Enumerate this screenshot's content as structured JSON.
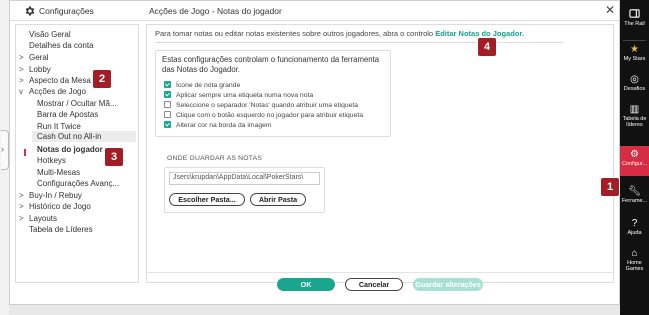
{
  "window": {
    "left_title": "Configurações",
    "right_title": "Acções de Jogo - Notas do jogador"
  },
  "sidebar": {
    "items": [
      {
        "label": "Visão Geral",
        "chevron": ""
      },
      {
        "label": "Detalhes da conta",
        "chevron": ""
      },
      {
        "label": "Geral",
        "chevron": ">"
      },
      {
        "label": "Lobby",
        "chevron": ">"
      },
      {
        "label": "Aspecto da Mesa",
        "chevron": ">"
      },
      {
        "label": "Acções de Jogo",
        "chevron": "v"
      },
      {
        "label": "Mostrar / Ocultar Mã...",
        "chevron": ""
      },
      {
        "label": "Barra de Apostas",
        "chevron": ""
      },
      {
        "label": "Run It Twice",
        "chevron": ""
      },
      {
        "label": "Cash Out no All-in",
        "chevron": ""
      },
      {
        "label": "Notas do jogador",
        "chevron": ""
      },
      {
        "label": "Hotkeys",
        "chevron": ""
      },
      {
        "label": "Multi-Mesas",
        "chevron": ""
      },
      {
        "label": "Configurações Avanç...",
        "chevron": ""
      },
      {
        "label": "Buy-In / Rebuy",
        "chevron": ">"
      },
      {
        "label": "Histórico de Jogo",
        "chevron": ">"
      },
      {
        "label": "Layouts",
        "chevron": ">"
      },
      {
        "label": "Tabela de Líderes",
        "chevron": ""
      }
    ]
  },
  "main": {
    "info_text": "Para tomar notas ou editar notas existentes sobre outros jogadores, abra o controlo",
    "info_link": "Editar Notas do Jogador.",
    "settings_heading": "Estas configurações controlam o funcionamento da ferramenta das Notas do Jogador.",
    "options": [
      {
        "label": "Ícone de nota grande",
        "checked": true
      },
      {
        "label": "Aplicar sempre uma etiqueta numa nova nota",
        "checked": true
      },
      {
        "label": "Seleccione o separador 'Notas' quando atribuir uma etiqueta",
        "checked": false
      },
      {
        "label": "Clique com o botão esquerdo no jogador para atribuir etiqueta",
        "checked": false
      },
      {
        "label": "Alterar cor na borda da imagem",
        "checked": true
      }
    ],
    "where_label": "ONDE GUARDAR AS NOTAS",
    "path_value": "Jsers\\krupdan\\AppData\\Local\\PokerStars\\",
    "choose_folder": "Escolher Pasta...",
    "open_folder": "Abrir Pasta"
  },
  "footer": {
    "ok": "OK",
    "cancel": "Cancelar",
    "save": "Guardar alterações"
  },
  "badges": [
    "1",
    "2",
    "3",
    "4"
  ],
  "rail": [
    {
      "label": "The Rail",
      "icon": "rail-icon"
    },
    {
      "label": "My Stars",
      "icon": "star-icon"
    },
    {
      "label": "Desafios",
      "icon": "challenges-icon"
    },
    {
      "label": "Tabela de líderes",
      "icon": "leaderboard-icon"
    },
    {
      "label": "Configur...",
      "icon": "gear-icon"
    },
    {
      "label": "Ferrame...",
      "icon": "wrench-icon"
    },
    {
      "label": "Ajuda",
      "icon": "help-icon"
    },
    {
      "label": "Home Games",
      "icon": "home-icon"
    }
  ],
  "colors": {
    "accent": "#19a58e",
    "brand_red": "#d62d45",
    "badge": "#a31d24"
  }
}
